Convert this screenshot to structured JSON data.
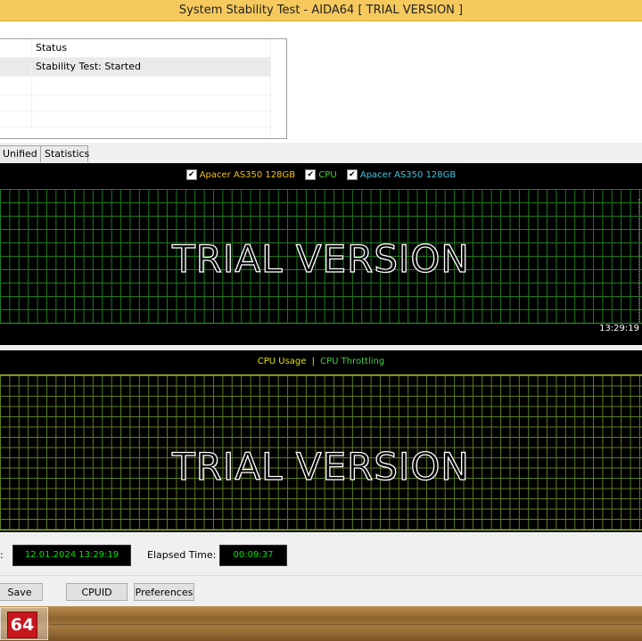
{
  "window": {
    "title": "System Stability Test - AIDA64  [ TRIAL VERSION ]"
  },
  "status_table": {
    "header": "Status",
    "rows": [
      "Stability Test: Started",
      "",
      "",
      ""
    ]
  },
  "tabs": [
    {
      "label": "Unified"
    },
    {
      "label": "Statistics"
    }
  ],
  "graph1": {
    "legend": [
      {
        "label": "Apacer AS350 128GB",
        "color": "#f0c020",
        "checked": true
      },
      {
        "label": "CPU",
        "color": "#40d040",
        "checked": true
      },
      {
        "label": "Apacer AS350 128GB",
        "color": "#40c8e0",
        "checked": true
      }
    ],
    "watermark": "TRIAL VERSION",
    "time_label": "13:29:19"
  },
  "graph2": {
    "legend": [
      {
        "label": "CPU Usage",
        "color": "#e0e000"
      },
      {
        "label": "|",
        "color": "#e0e000"
      },
      {
        "label": "CPU Throttling",
        "color": "#40d040"
      }
    ],
    "watermark": "TRIAL VERSION"
  },
  "info": {
    "colon": ":",
    "started_value": "12.01.2024 13:29:19",
    "elapsed_label": "Elapsed Time:",
    "elapsed_value": "00:09:37"
  },
  "buttons": {
    "save": "Save",
    "cpuid": "CPUID",
    "preferences": "Preferences"
  },
  "taskbar": {
    "app_icon_text": "64"
  }
}
